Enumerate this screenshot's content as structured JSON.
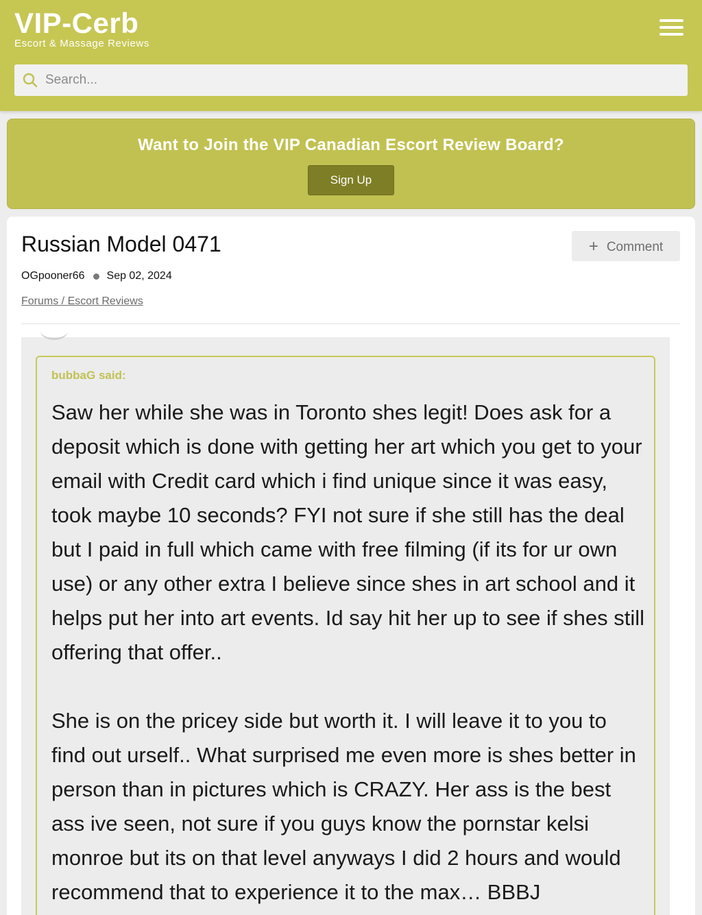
{
  "header": {
    "logo": "VIP-Cerb",
    "tagline": "Escort & Massage Reviews",
    "search_placeholder": "Search...",
    "menu_icon": "hamburger-menu-icon",
    "search_icon": "search-icon"
  },
  "banner": {
    "title": "Want to Join the VIP Canadian Escort Review Board?",
    "signup_label": "Sign Up"
  },
  "thread": {
    "title": "Russian Model 0471",
    "comment_label": "Comment",
    "author": "OGpooner66",
    "date": "Sep 02, 2024",
    "breadcrumb": "Forums / Escort Reviews"
  },
  "quote": {
    "author": "bubbaG said:",
    "paragraphs": [
      "Saw her while she was in Toronto shes legit! Does ask for a deposit which is done with getting her art which you get to your email with Credit card which i find unique since it was easy, took maybe 10 seconds? FYI not sure if she still has the deal but I paid in full which came with free filming (if its for ur own use) or any other extra I believe since shes in art school and it helps put her into art events. Id say hit her up to see if shes still offering that offer..",
      "She is on the pricey side but worth it. I will leave it to you to find out urself.. What surprised me even more is shes better in person than in pictures which is CRAZY. Her ass is the best ass ive seen, not sure if you guys know the pornstar kelsi monroe but its on that level anyways I did 2 hours and would recommend that to experience it to the max… BBBJ"
    ]
  },
  "colors": {
    "brand": "#c6c653",
    "button_dark": "#7e7e26",
    "quote_border": "#c8c85a"
  }
}
